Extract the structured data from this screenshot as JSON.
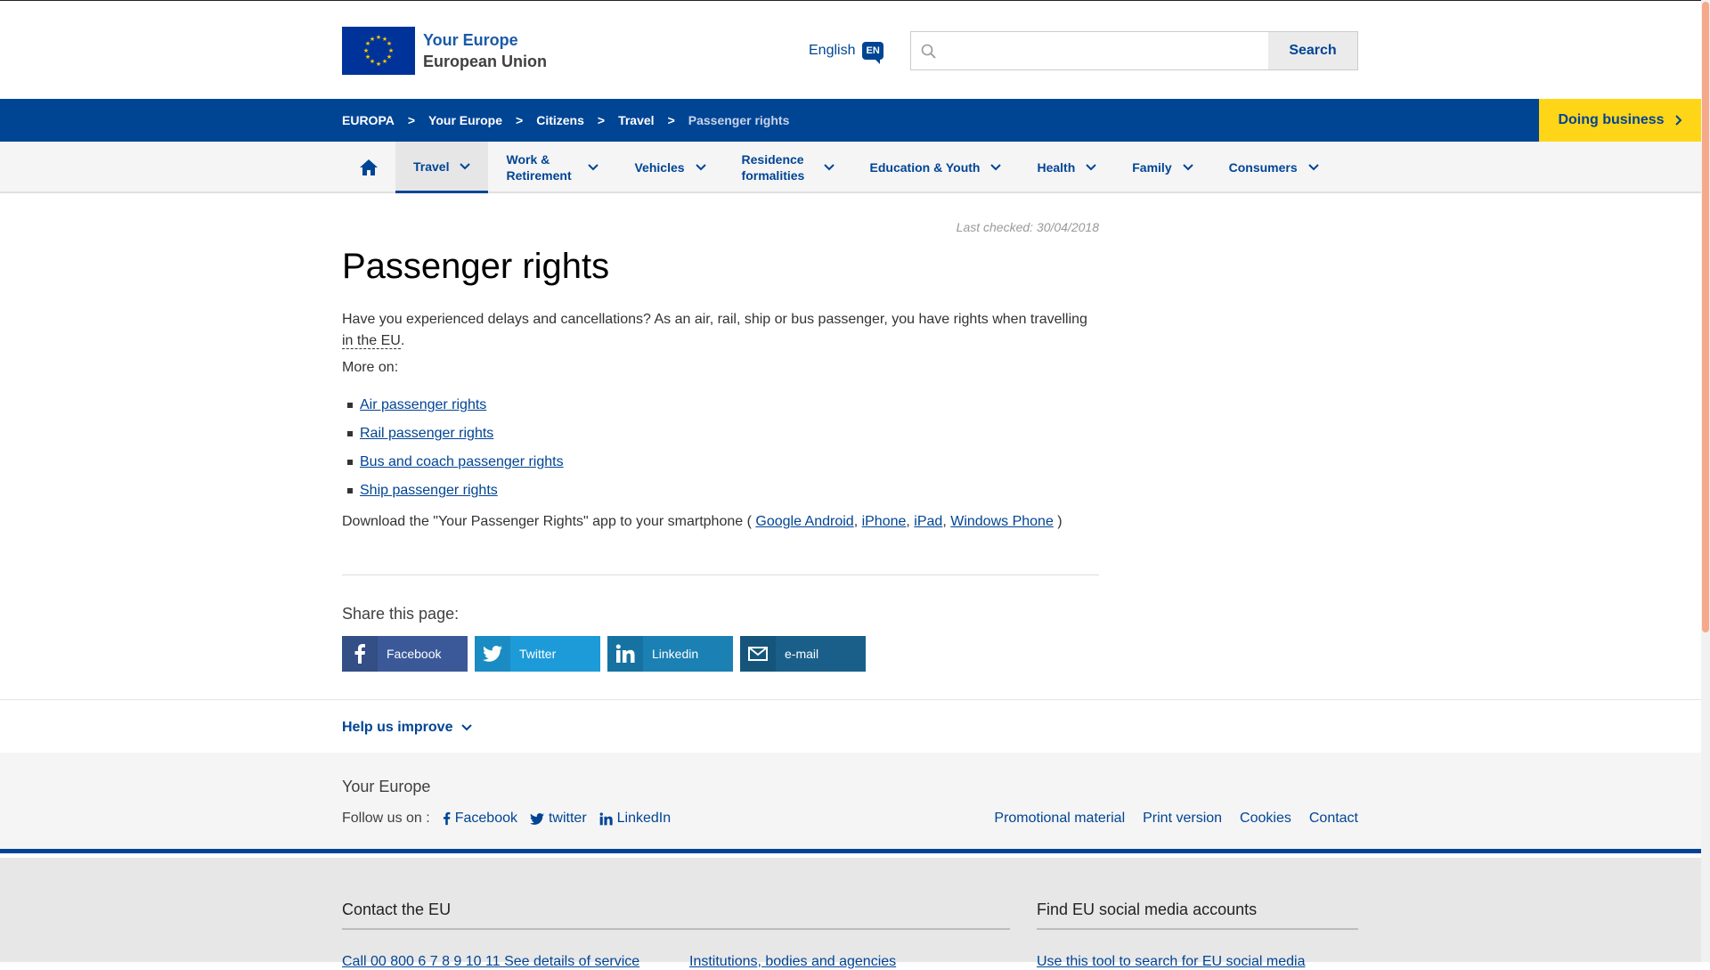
{
  "header": {
    "site_title_line1": "Your Europe",
    "site_title_line2": "European Union",
    "language": "English",
    "language_code": "EN",
    "search_placeholder": "",
    "search_button": "Search"
  },
  "breadcrumb": {
    "items": [
      "EUROPA",
      "Your Europe",
      "Citizens",
      "Travel"
    ],
    "current": "Passenger rights",
    "separator": ">",
    "doing_business": "Doing business"
  },
  "nav": {
    "items": [
      {
        "label": "Travel",
        "active": true
      },
      {
        "label": "Work & Retirement"
      },
      {
        "label": "Vehicles"
      },
      {
        "label": "Residence formalities"
      },
      {
        "label": "Education & Youth"
      },
      {
        "label": "Health"
      },
      {
        "label": "Family"
      },
      {
        "label": "Consumers"
      }
    ]
  },
  "content": {
    "last_checked": "Last checked: 30/04/2018",
    "title": "Passenger rights",
    "intro_text": "Have you experienced delays and cancellations? As an air, rail, ship or bus passenger, you have rights when travelling ",
    "intro_abbr": "in the EU",
    "intro_end": ".",
    "more_on": "More on:",
    "links": [
      "Air passenger rights",
      "Rail passenger rights",
      "Bus and coach passenger rights",
      "Ship passenger rights"
    ],
    "download_text": "Download the \"Your Passenger Rights\" app to your smartphone ( ",
    "download_links": [
      "Google Android",
      "iPhone",
      "iPad",
      "Windows Phone"
    ],
    "download_end": " )",
    "share_label": "Share this page:",
    "share_buttons": [
      "Facebook",
      "Twitter",
      "Linkedin",
      "e-mail"
    ]
  },
  "help": {
    "label": "Help us improve"
  },
  "footer": {
    "title": "Your Europe",
    "follow_label": "Follow us on :",
    "social": [
      "Facebook",
      "twitter",
      "LinkedIn"
    ],
    "links": [
      "Promotional material",
      "Print version",
      "Cookies",
      "Contact"
    ],
    "contact_title": "Contact the EU",
    "social_title": "Find EU social media accounts",
    "contact_sub1": "Call 00 800 6 7 8 9 10 11  See details of service",
    "contact_sub2": "Institutions, bodies and agencies",
    "social_sub": "Use this tool to search for EU social media"
  },
  "colors": {
    "brand_blue": "#004494",
    "accent_yellow": "#ffd617",
    "facebook": "#3b5998",
    "twitter": "#1d9bd8",
    "linkedin": "#1b80b3",
    "email": "#1a5f8a"
  }
}
